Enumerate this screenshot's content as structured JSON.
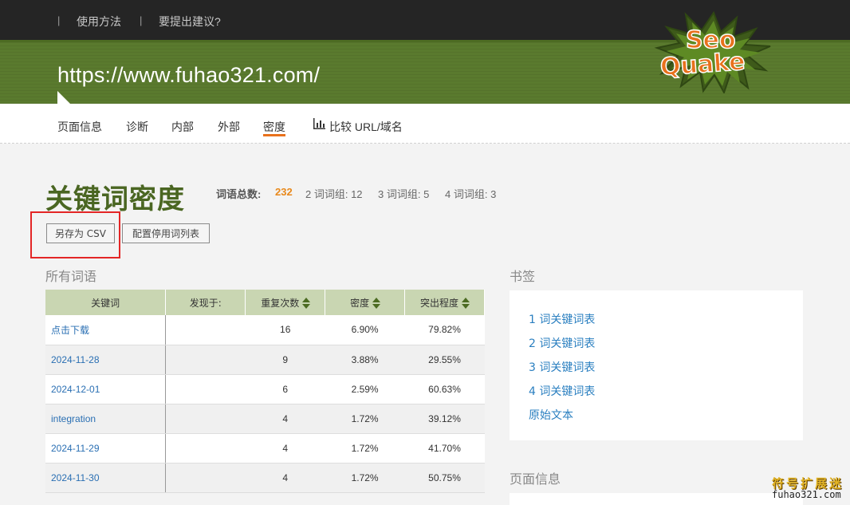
{
  "top_nav": {
    "separator": "|",
    "how_to_use": "使用方法",
    "suggestion": "要提出建议?"
  },
  "header": {
    "site_url": "https://www.fuhao321.com/",
    "logo_text_top": "Seo",
    "logo_text_bottom": "Quake"
  },
  "tabs": [
    {
      "label": "页面信息"
    },
    {
      "label": "诊断"
    },
    {
      "label": "内部"
    },
    {
      "label": "外部"
    },
    {
      "label": "密度",
      "active": true
    },
    {
      "label": "比较 URL/域名"
    }
  ],
  "page": {
    "title": "关键词密度",
    "stats": {
      "total_label": "词语总数:",
      "total_value": "232",
      "two_word": "2 词词组: 12",
      "three_word": "3 词词组: 5",
      "four_word": "4 词词组: 3"
    },
    "buttons": {
      "save_csv": "另存为 CSV",
      "configure_stopwords": "配置停用词列表"
    }
  },
  "all_words": {
    "heading": "所有词语",
    "columns": [
      "关键词",
      "发现于:",
      "重复次数",
      "密度",
      "突出程度"
    ],
    "rows": [
      {
        "keyword": "点击下载",
        "found": "",
        "count": "16",
        "density": "6.90%",
        "prominence": "79.82%"
      },
      {
        "keyword": "2024-11-28",
        "found": "",
        "count": "9",
        "density": "3.88%",
        "prominence": "29.55%"
      },
      {
        "keyword": "2024-12-01",
        "found": "",
        "count": "6",
        "density": "2.59%",
        "prominence": "60.63%"
      },
      {
        "keyword": "integration",
        "found": "",
        "count": "4",
        "density": "1.72%",
        "prominence": "39.12%"
      },
      {
        "keyword": "2024-11-29",
        "found": "",
        "count": "4",
        "density": "1.72%",
        "prominence": "41.70%"
      },
      {
        "keyword": "2024-11-30",
        "found": "",
        "count": "4",
        "density": "1.72%",
        "prominence": "50.75%"
      }
    ]
  },
  "bookmarks": {
    "heading": "书签",
    "links": [
      "1 词关键词表",
      "2 词关键词表",
      "3 词关键词表",
      "4 词关键词表",
      "原始文本"
    ]
  },
  "page_info_heading": "页面信息",
  "watermark": {
    "line1": "符号扩展迷",
    "line2": "fuhao321.com"
  },
  "colors": {
    "header_green": "#5a7a2e",
    "title_green": "#4a6622",
    "accent_orange": "#e8711c",
    "link_blue": "#2a7fc0",
    "highlight_red": "#e32626"
  }
}
